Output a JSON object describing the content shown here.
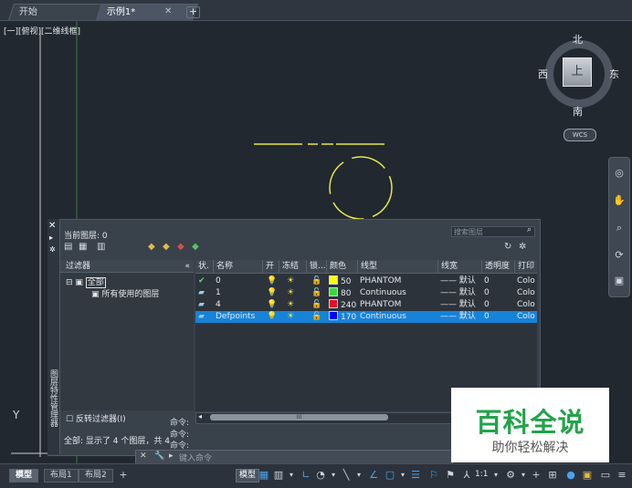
{
  "doc_tabs": [
    {
      "label": "开始"
    },
    {
      "label": "示例1*"
    }
  ],
  "viewport_label": "[一][俯视][二维线框]",
  "compass": {
    "north": "北",
    "south": "南",
    "east": "东",
    "west": "西",
    "top": "上",
    "wcs": "WCS"
  },
  "layer_panel": {
    "side_title": "图层特性管理器",
    "current_layer": "当前图层: 0",
    "search_placeholder": "搜索图层",
    "filter_header": "过滤器",
    "tree": {
      "all": "全部",
      "used": "所有使用的图层"
    },
    "columns": [
      "状.",
      "名称",
      "开",
      "冻结",
      "锁...",
      "颜色",
      "线型",
      "线宽",
      "透明度",
      "打印"
    ],
    "layers": [
      {
        "name": "0",
        "color_label": "50",
        "color_hex": "#ffff00",
        "linetype": "PHANTOM",
        "lineweight": "—— 默认",
        "transparency": "0",
        "plot": "Colo",
        "selected": false
      },
      {
        "name": "1",
        "color_label": "80",
        "color_hex": "#3cd63c",
        "linetype": "Continuous",
        "lineweight": "—— 默认",
        "transparency": "0",
        "plot": "Colo",
        "selected": false
      },
      {
        "name": "4",
        "color_label": "240",
        "color_hex": "#e0102a",
        "linetype": "PHANTOM",
        "lineweight": "—— 默认",
        "transparency": "0",
        "plot": "Colo",
        "selected": false
      },
      {
        "name": "Defpoints",
        "color_label": "170",
        "color_hex": "#0000ff",
        "linetype": "Continuous",
        "lineweight": "—— 默认",
        "transparency": "0",
        "plot": "Colo",
        "selected": true
      }
    ],
    "invert_filter": "反转过滤器(I)",
    "status": "全部: 显示了 4 个图层，共 4",
    "scroll_label": "III"
  },
  "command": {
    "history": [
      "命令:",
      "命令:",
      "命令:"
    ],
    "placeholder": "键入命令"
  },
  "ucs": {
    "y": "Y"
  },
  "layout_tabs": [
    {
      "label": "模型"
    },
    {
      "label": "布局1"
    },
    {
      "label": "布局2"
    }
  ],
  "status_bar": {
    "model": "模型",
    "scale": "1:1"
  },
  "watermark": {
    "title": "百科全说",
    "subtitle": "助你轻松解决"
  },
  "colors": {
    "accent": "#1683d8",
    "background": "#212830",
    "drawing": "#e8e84a"
  }
}
